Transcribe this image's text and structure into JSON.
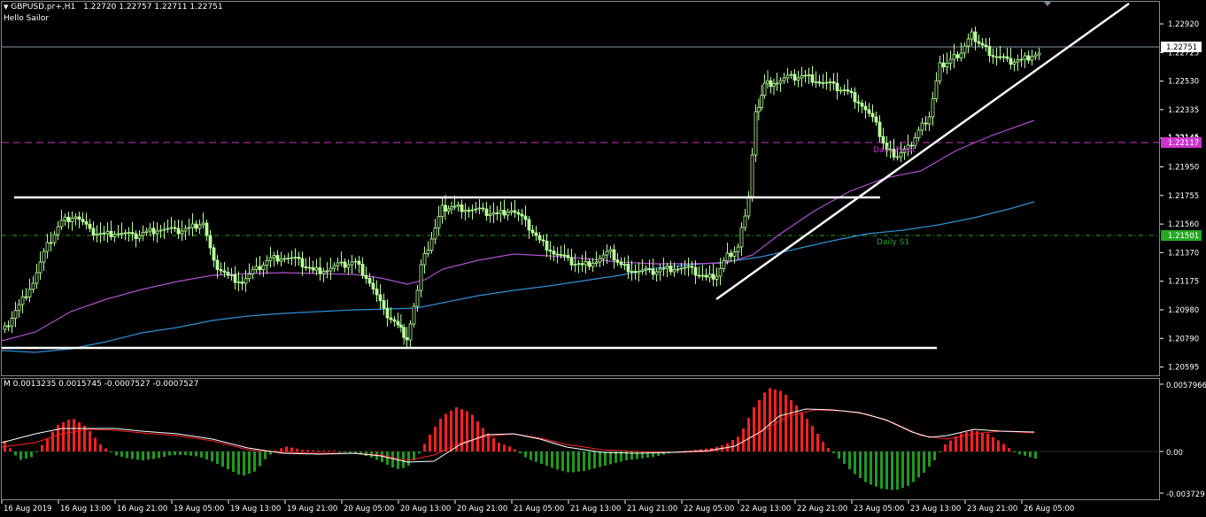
{
  "header": {
    "symbol": "GBPUSD.pr+,H1",
    "ohlc": "1.22720 1.22757 1.22711 1.22751",
    "indicator_name": "Hello Sailor"
  },
  "sub_header": "M 0.0013235 0.0015745 -0.0007527 -0.0007527",
  "price_axis": {
    "ticks": [
      "1.22920",
      "1.22725",
      "1.22530",
      "1.22335",
      "1.22140",
      "1.21950",
      "1.21755",
      "1.21560",
      "1.21370",
      "1.21175",
      "1.20980",
      "1.20790",
      "1.20595"
    ],
    "current_price": "1.22751",
    "pivot_label": "1.22117",
    "pivot_under": "1.22145",
    "s1_label": "1.21501"
  },
  "osc_axis": {
    "ticks": [
      "0.0057966",
      "0.00",
      "-0.003729"
    ]
  },
  "time_axis": [
    "16 Aug 2019",
    "16 Aug 13:00",
    "16 Aug 21:00",
    "19 Aug 05:00",
    "19 Aug 13:00",
    "19 Aug 21:00",
    "20 Aug 05:00",
    "20 Aug 13:00",
    "20 Aug 21:00",
    "21 Aug 05:00",
    "21 Aug 13:00",
    "21 Aug 21:00",
    "22 Aug 05:00",
    "22 Aug 13:00",
    "22 Aug 21:00",
    "23 Aug 05:00",
    "23 Aug 13:00",
    "23 Aug 21:00",
    "26 Aug 05:00"
  ],
  "labels": {
    "daily_pivot": "Daily Pivot",
    "daily_s1": "Daily S1"
  },
  "colors": {
    "background": "#000000",
    "candle": "#b8ff9a",
    "pivot": "#cc33cc",
    "s1": "#22aa22",
    "ma_fast": "#b050d0",
    "ma_slow": "#2f8fd8",
    "hist_pos": "#ff2020",
    "hist_neg": "#1e9a1e",
    "osc_main": "#ffffff",
    "osc_signal": "#ff2020",
    "trendline": "#ffffff"
  }
}
